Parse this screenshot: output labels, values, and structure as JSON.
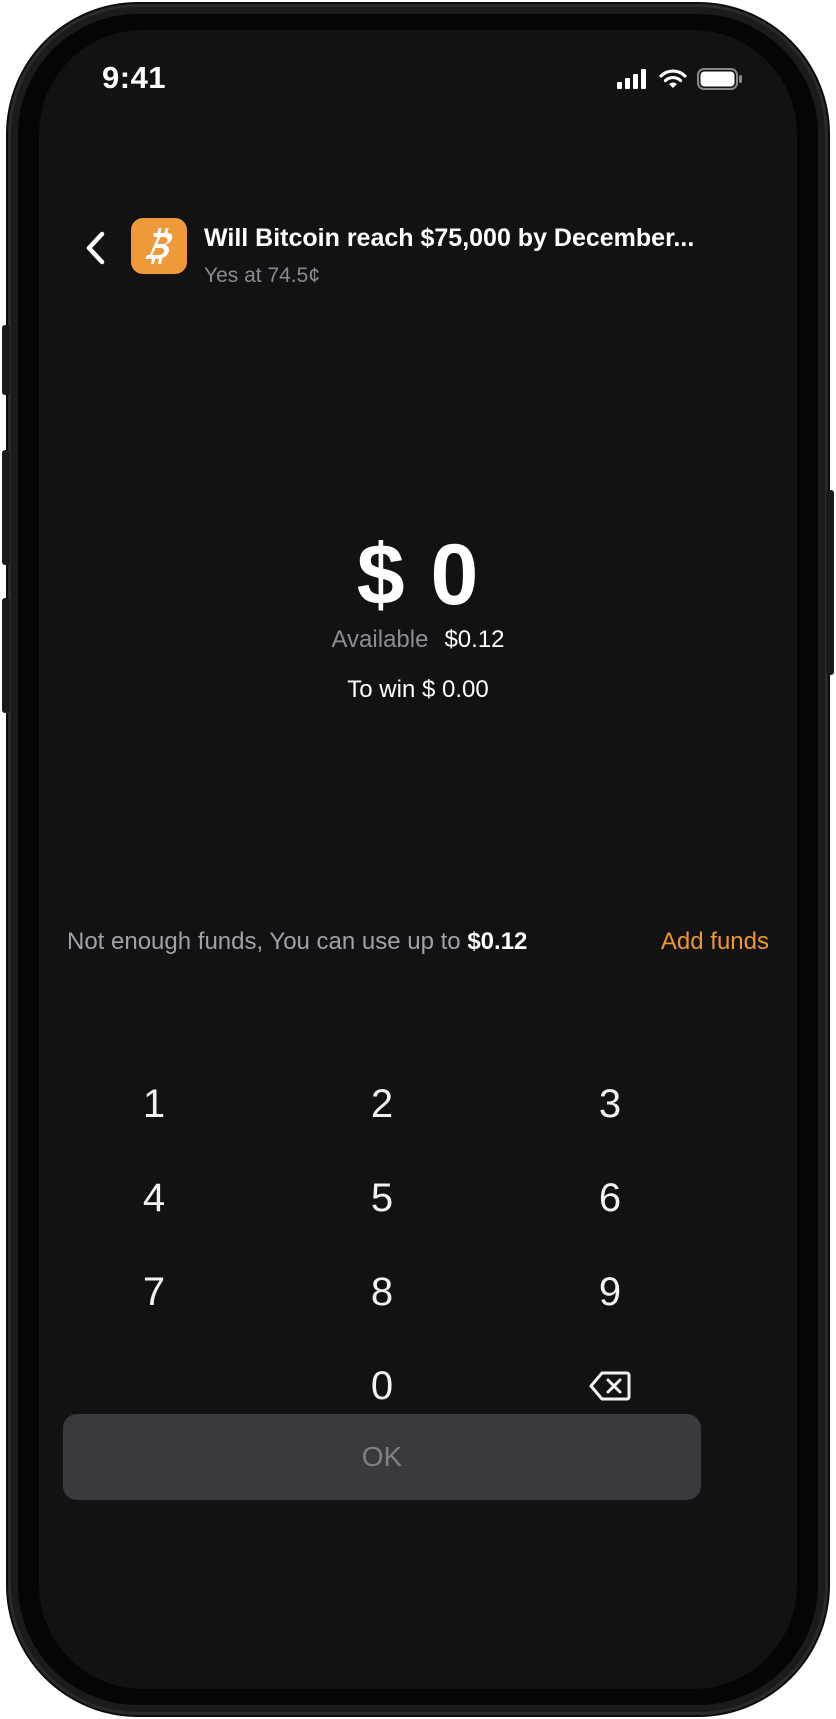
{
  "status_bar": {
    "time": "9:41"
  },
  "header": {
    "title": "Will Bitcoin reach $75,000 by December...",
    "subtitle": "Yes at 74.5¢",
    "coin_icon": "bitcoin-icon"
  },
  "amount": {
    "value": "$ 0"
  },
  "available": {
    "label": "Available",
    "value": "$0.12"
  },
  "to_win": {
    "text": "To win $ 0.00"
  },
  "warning": {
    "text": "Not enough funds, You can use up to",
    "limit": "$0.12",
    "action": "Add funds"
  },
  "keypad": {
    "keys": [
      "1",
      "2",
      "3",
      "4",
      "5",
      "6",
      "7",
      "8",
      "9",
      ".",
      "0",
      "⌫"
    ]
  },
  "ok_button": {
    "label": "OK"
  },
  "colors": {
    "accent": "#f0962e",
    "coin": "#ee9a3a",
    "background": "#121214"
  }
}
